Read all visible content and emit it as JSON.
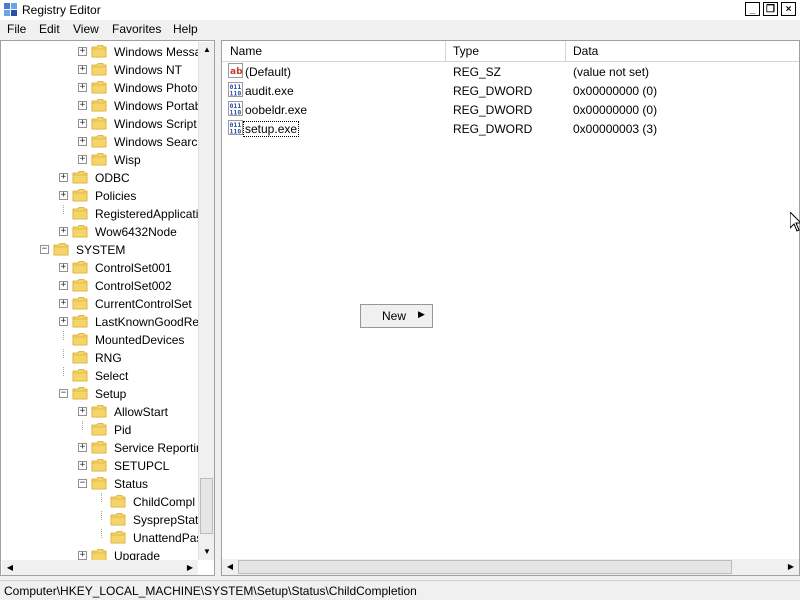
{
  "window": {
    "title": "Registry Editor",
    "minimize_glyph": "_",
    "restore_glyph": "❐",
    "close_glyph": "×"
  },
  "menu": {
    "file": "File",
    "edit": "Edit",
    "view": "View",
    "favorites": "Favorites",
    "help": "Help"
  },
  "tree": {
    "items": [
      {
        "label": "Windows Messa",
        "expander": "+"
      },
      {
        "label": "Windows NT",
        "expander": "+"
      },
      {
        "label": "Windows Photo",
        "expander": "+"
      },
      {
        "label": "Windows Portab",
        "expander": "+"
      },
      {
        "label": "Windows Script",
        "expander": "+"
      },
      {
        "label": "Windows Search",
        "expander": "+"
      },
      {
        "label": "Wisp",
        "expander": "+"
      },
      {
        "label": "ODBC",
        "expander": "+"
      },
      {
        "label": "Policies",
        "expander": "+"
      },
      {
        "label": "RegisteredApplicati",
        "expander": ""
      },
      {
        "label": "Wow6432Node",
        "expander": "+"
      },
      {
        "label": "SYSTEM",
        "expander": "−"
      },
      {
        "label": "ControlSet001",
        "expander": "+"
      },
      {
        "label": "ControlSet002",
        "expander": "+"
      },
      {
        "label": "CurrentControlSet",
        "expander": "+"
      },
      {
        "label": "LastKnownGoodRec",
        "expander": "+"
      },
      {
        "label": "MountedDevices",
        "expander": ""
      },
      {
        "label": "RNG",
        "expander": ""
      },
      {
        "label": "Select",
        "expander": ""
      },
      {
        "label": "Setup",
        "expander": "−"
      },
      {
        "label": "AllowStart",
        "expander": "+"
      },
      {
        "label": "Pid",
        "expander": ""
      },
      {
        "label": "Service Reportin",
        "expander": "+"
      },
      {
        "label": "SETUPCL",
        "expander": "+"
      },
      {
        "label": "Status",
        "expander": "−"
      },
      {
        "label": "ChildCompl",
        "expander": ""
      },
      {
        "label": "SysprepStatu",
        "expander": ""
      },
      {
        "label": "UnattendPas",
        "expander": ""
      },
      {
        "label": "Upgrade",
        "expander": "+"
      }
    ]
  },
  "list": {
    "columns": {
      "name": "Name",
      "type": "Type",
      "data": "Data"
    },
    "rows": [
      {
        "name": "(Default)",
        "type": "REG_SZ",
        "data": "(value not set)",
        "icon": "string-value-icon"
      },
      {
        "name": "audit.exe",
        "type": "REG_DWORD",
        "data": "0x00000000 (0)",
        "icon": "binary-value-icon"
      },
      {
        "name": "oobeldr.exe",
        "type": "REG_DWORD",
        "data": "0x00000000 (0)",
        "icon": "binary-value-icon"
      },
      {
        "name": "setup.exe",
        "type": "REG_DWORD",
        "data": "0x00000003 (3)",
        "icon": "binary-value-icon"
      }
    ]
  },
  "context_menu": {
    "new_label": "New",
    "submenu_arrow": "▶"
  },
  "status": {
    "path": "Computer\\HKEY_LOCAL_MACHINE\\SYSTEM\\Setup\\Status\\ChildCompletion"
  },
  "colors": {
    "folder": "#f5d56a",
    "folder_dark": "#d9a929",
    "dword_icon": "#2a4fa8",
    "string_icon": "#c0392b"
  }
}
